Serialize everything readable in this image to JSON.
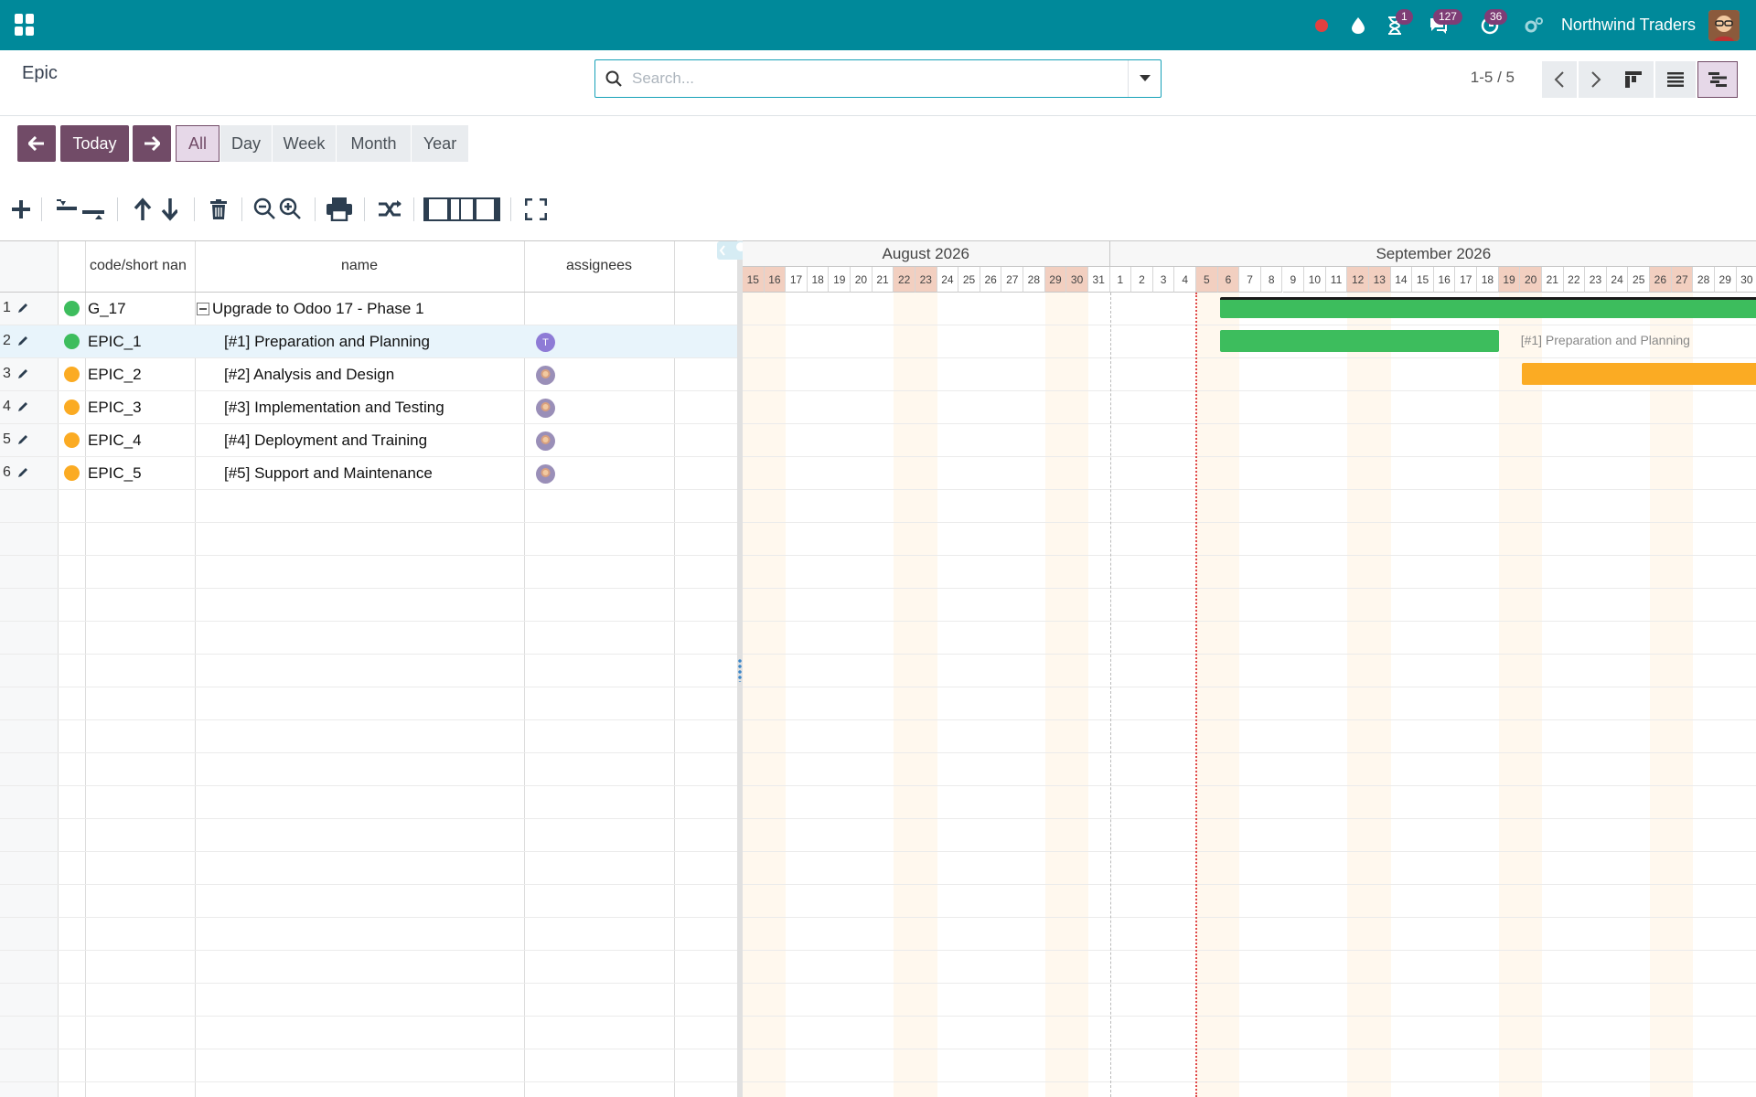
{
  "navbar": {
    "company": "Northwind Traders",
    "badges": {
      "activities": "1",
      "messages": "127",
      "timer": "36"
    },
    "colors": {
      "bar": "#00899a",
      "badge": "#7e3d76",
      "record": "#e04040"
    }
  },
  "control": {
    "breadcrumb": "Epic",
    "search_placeholder": "Search...",
    "pager": "1-5 / 5"
  },
  "scale": {
    "today": "Today",
    "buttons": [
      "All",
      "Day",
      "Week",
      "Month",
      "Year"
    ],
    "active": "All"
  },
  "grid": {
    "headers": {
      "code": "code/short nan",
      "name": "name",
      "assignees": "assignees"
    },
    "rows": [
      {
        "num": "1",
        "status": "green",
        "code": "G_17",
        "name": "Upgrade to Odoo 17 - Phase 1",
        "level": 0,
        "assignee": ""
      },
      {
        "num": "2",
        "status": "green",
        "code": "EPIC_1",
        "name": "[#1] Preparation and Planning",
        "level": 1,
        "assignee": "T"
      },
      {
        "num": "3",
        "status": "orange",
        "code": "EPIC_2",
        "name": "[#2] Analysis and Design",
        "level": 1,
        "assignee": "photo"
      },
      {
        "num": "4",
        "status": "orange",
        "code": "EPIC_3",
        "name": "[#3] Implementation and Testing",
        "level": 1,
        "assignee": "photo"
      },
      {
        "num": "5",
        "status": "orange",
        "code": "EPIC_4",
        "name": "[#4] Deployment and Training",
        "level": 1,
        "assignee": "photo"
      },
      {
        "num": "6",
        "status": "orange",
        "code": "EPIC_5",
        "name": "[#5] Support and Maintenance",
        "level": 1,
        "assignee": "photo"
      }
    ]
  },
  "timeline": {
    "months": [
      "August 2026",
      "September 2026"
    ],
    "august_days": [
      "15",
      "16",
      "17",
      "18",
      "19",
      "20",
      "21",
      "22",
      "23",
      "24",
      "25",
      "26",
      "27",
      "28",
      "29",
      "30",
      "31"
    ],
    "september_days": [
      "1",
      "2",
      "3",
      "4",
      "5",
      "6",
      "7",
      "8",
      "9",
      "10",
      "11",
      "12",
      "13",
      "14",
      "15",
      "16",
      "17",
      "18",
      "19",
      "20",
      "21",
      "22",
      "23",
      "24",
      "25",
      "26",
      "27",
      "28",
      "29",
      "30"
    ],
    "today": "2026-09-05",
    "bar_label": "[#1] Preparation and Planning",
    "colors": {
      "green": "#3dbd5d",
      "orange": "#fbab23",
      "weekend": "#f2cfc0",
      "today": "#e04a4a"
    },
    "tasks": [
      {
        "row": 1,
        "start": "2026-09-06",
        "end": "2026-09-30",
        "color": "green",
        "summary": true
      },
      {
        "row": 2,
        "start": "2026-09-06",
        "end": "2026-09-18",
        "color": "green"
      },
      {
        "row": 3,
        "start": "2026-09-20",
        "end": "2026-09-30",
        "color": "orange"
      }
    ]
  }
}
